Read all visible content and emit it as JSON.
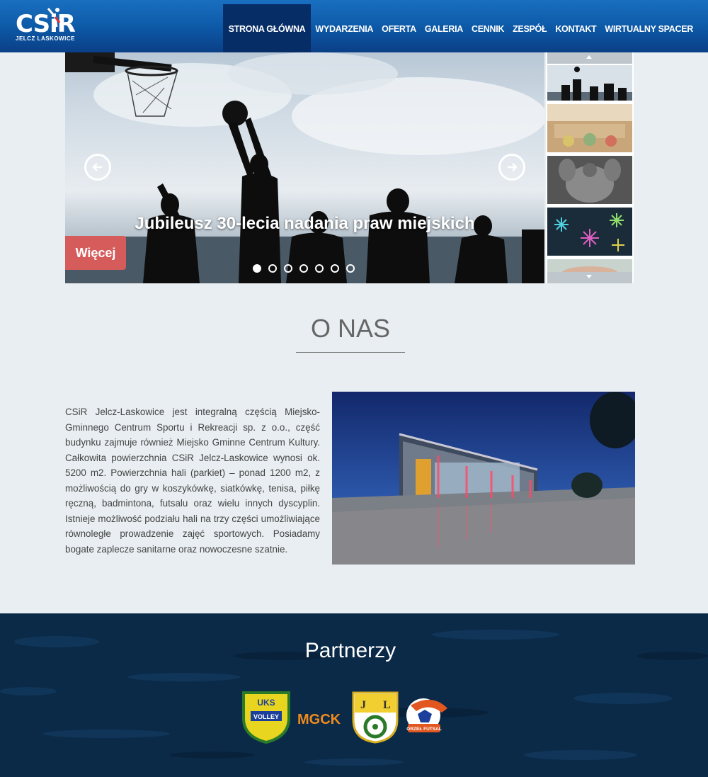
{
  "brand": {
    "logo_text": "CSiR",
    "logo_sub": "JELCZ LASKOWICE"
  },
  "nav": {
    "items": [
      {
        "label": "STRONA GŁÓWNA",
        "active": true
      },
      {
        "label": "WYDARZENIA",
        "active": false
      },
      {
        "label": "OFERTA",
        "active": false
      },
      {
        "label": "GALERIA",
        "active": false
      },
      {
        "label": "CENNIK",
        "active": false
      },
      {
        "label": "ZESPÓŁ",
        "active": false
      },
      {
        "label": "KONTAKT",
        "active": false
      },
      {
        "label": "WIRTUALNY SPACER",
        "active": false
      }
    ]
  },
  "slider": {
    "title": "Jubileusz 30-lecia nadania praw miejskich",
    "more_label": "Więcej",
    "dot_count": 7,
    "active_dot": 1,
    "prev_icon": "arrow-left-icon",
    "next_icon": "arrow-right-icon"
  },
  "thumbnails": [
    {
      "name": "thumb-basketball"
    },
    {
      "name": "thumb-gym-room"
    },
    {
      "name": "thumb-muscles"
    },
    {
      "name": "thumb-snowflakes"
    },
    {
      "name": "thumb-hands"
    }
  ],
  "about": {
    "title": "O NAS",
    "text": "CSiR Jelcz-Laskowice jest integralną częścią Miejsko-Gminnego Centrum Sportu i Rekreacji sp. z o.o., część budynku zajmuje również Miejsko Gminne Centrum Kultury. Całkowita powierzchnia CSiR Jelcz-Laskowice wynosi ok. 5200 m2. Powierzchnia hali (parkiet) – ponad 1200 m2, z możliwością do gry w koszykówkę, siatkówkę, tenisa, piłkę ręczną, badmintona, futsalu oraz wielu innych dyscyplin. Istnieje możliwość podziału hali na trzy części umożliwiające równoległe prowadzenie zajęć sportowych. Posiadamy bogate zaplecze sanitarne oraz nowoczesne szatnie."
  },
  "footer": {
    "partners_title": "Partnerzy",
    "partners": [
      {
        "name": "Volley",
        "logo_text": "VOLLEY",
        "color": "#e8d51f"
      },
      {
        "name": "MGCK",
        "logo_text": "MGCK",
        "color": "#f08a1c"
      },
      {
        "name": "Jelcz-Laskowice",
        "logo_text": "J L",
        "color": "#2a7a2a"
      },
      {
        "name": "Orzeł Futsal",
        "logo_text": "ORZEŁ FUTSAL",
        "color": "#e2561f"
      }
    ]
  },
  "colors": {
    "nav_bg": "#0d5aa8",
    "nav_active": "#062d66",
    "more_button": "#d65b5b",
    "footer_bg": "#0a2947"
  }
}
